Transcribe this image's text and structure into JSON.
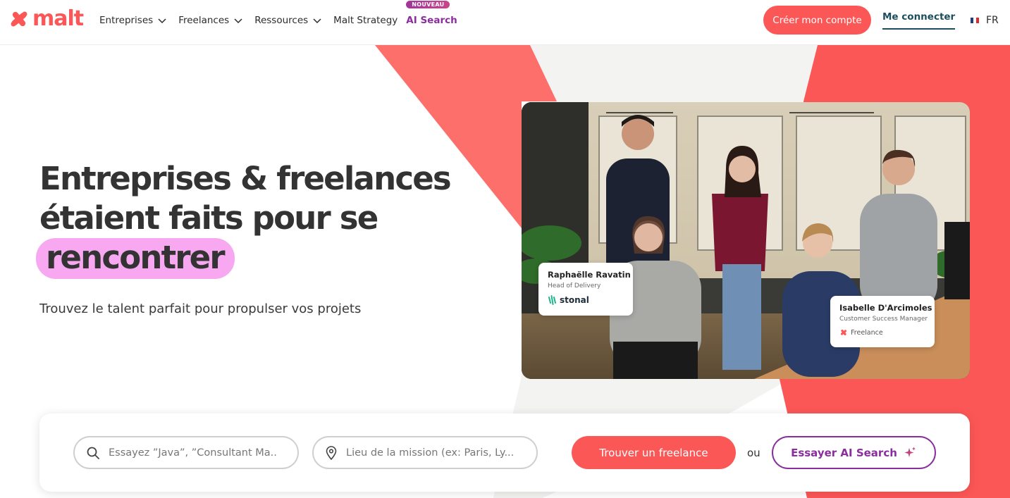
{
  "brand": {
    "name": "malt",
    "color": "#fc5757"
  },
  "nav": {
    "items": [
      {
        "label": "Entreprises",
        "has_dropdown": true
      },
      {
        "label": "Freelances",
        "has_dropdown": true
      },
      {
        "label": "Ressources",
        "has_dropdown": true
      },
      {
        "label": "Malt Strategy",
        "has_dropdown": false
      }
    ],
    "ai_search": {
      "badge": "NOUVEAU",
      "label": "AI Search"
    }
  },
  "header_actions": {
    "create_account": "Créer mon compte",
    "login": "Me connecter",
    "language": "FR"
  },
  "hero": {
    "title_line1": "Entreprises & freelances",
    "title_line2": "étaient faits pour se",
    "title_highlight": "rencontrer",
    "subtitle": "Trouvez le talent parfait pour propulser vos projets"
  },
  "photo_cards": [
    {
      "name": "Raphaëlle Ravatin",
      "role": "Head of Delivery",
      "company": "stonal"
    },
    {
      "name": "Isabelle D'Arcimoles",
      "role": "Customer Success Manager",
      "company": "Freelance"
    }
  ],
  "search": {
    "skill_placeholder": "Essayez ”Java”, ”Consultant Ma...",
    "location_placeholder": "Lieu de la mission (ex: Paris, Ly...",
    "find_button": "Trouver un freelance",
    "or_text": "ou",
    "ai_button": "Essayer AI Search"
  },
  "colors": {
    "accent": "#fc5757",
    "ai_purple": "#8a2e9e",
    "highlight_pink": "#f7a8f0",
    "login_teal": "#1e4e5e"
  }
}
